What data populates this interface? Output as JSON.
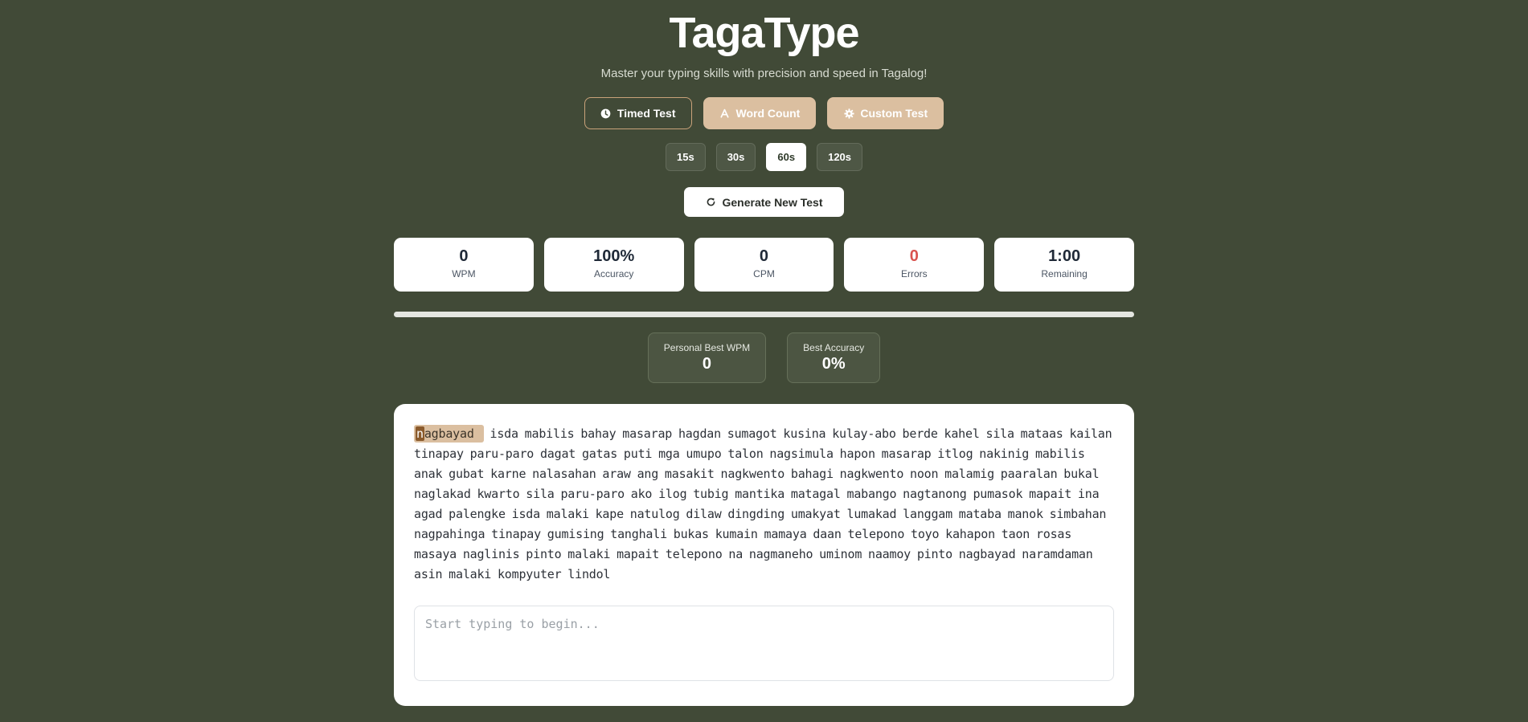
{
  "header": {
    "title": "TagaType",
    "subtitle": "Master your typing skills with precision and speed in Tagalog!"
  },
  "modes": [
    {
      "label": "Timed Test",
      "icon": "clock-icon",
      "active": true
    },
    {
      "label": "Word Count",
      "icon": "letter-a-icon",
      "active": false
    },
    {
      "label": "Custom Test",
      "icon": "gear-icon",
      "active": false
    }
  ],
  "durations": {
    "options": [
      "15s",
      "30s",
      "60s",
      "120s"
    ],
    "selected": "60s"
  },
  "generate": {
    "label": "Generate New Test",
    "icon": "refresh-icon"
  },
  "stats": {
    "wpm": {
      "value": "0",
      "label": "WPM"
    },
    "accuracy": {
      "value": "100%",
      "label": "Accuracy"
    },
    "cpm": {
      "value": "0",
      "label": "CPM"
    },
    "errors": {
      "value": "0",
      "label": "Errors"
    },
    "remaining": {
      "value": "1:00",
      "label": "Remaining"
    }
  },
  "progress": {
    "value": 0
  },
  "bests": {
    "wpm": {
      "label": "Personal Best WPM",
      "value": "0"
    },
    "accuracy": {
      "label": "Best Accuracy",
      "value": "0%"
    }
  },
  "test": {
    "current_word_first_char": "n",
    "current_word_rest": "agbayad",
    "words": "isda mabilis bahay masarap hagdan sumagot kusina kulay-abo berde kahel sila mataas kailan tinapay paru-paro dagat gatas puti mga umupo talon nagsimula hapon masarap itlog nakinig mabilis anak gubat karne nalasahan araw ang masakit nagkwento bahagi nagkwento noon malamig paaralan bukal naglakad kwarto sila paru-paro ako ilog tubig mantika matagal mabango nagtanong pumasok mapait ina agad palengke isda malaki kape natulog dilaw dingding umakyat lumakad langgam mataba manok simbahan nagpahinga tinapay gumising tanghali bukas kumain mamaya daan telepono toyo kahapon taon rosas masaya naglinis pinto malaki mapait telepono na nagmaneho uminom naamoy pinto nagbayad naramdaman asin malaki kompyuter lindol",
    "input_placeholder": "Start typing to begin...",
    "input_value": ""
  },
  "colors": {
    "background": "#414a37",
    "accent": "#dbbfa0",
    "error": "#d9534f",
    "caret": "#8a5a2b"
  }
}
